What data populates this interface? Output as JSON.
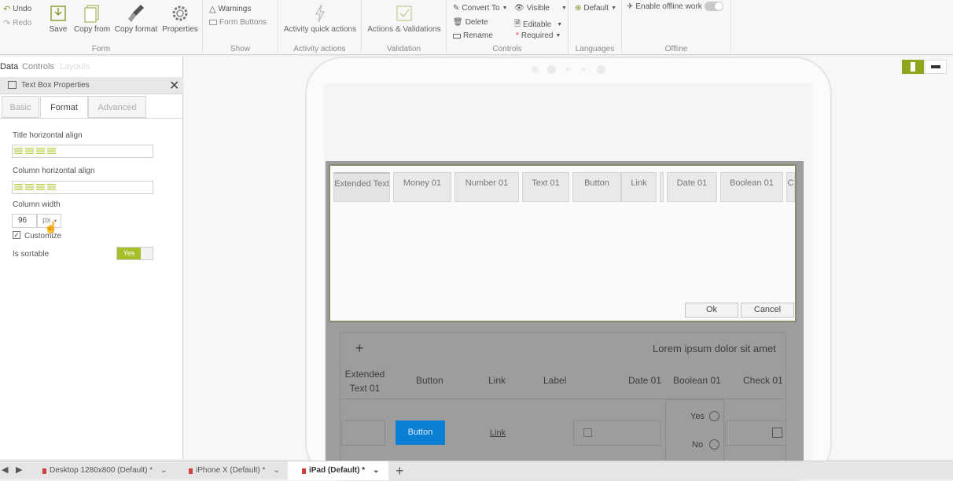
{
  "ribbon": {
    "undo": "Undo",
    "redo": "Redo",
    "save": "Save",
    "copy_from": "Copy from",
    "copy_format": "Copy format",
    "properties": "Properties",
    "form_group": "Form",
    "warnings": "Warnings",
    "form_buttons": "Form Buttons",
    "show_group": "Show",
    "activity_quick_actions": "Activity quick actions",
    "activity_actions_group": "Activity actions",
    "actions_validations": "Actions & Validations",
    "validation_group": "Validation",
    "convert_to": "Convert To",
    "delete": "Delete",
    "rename": "Rename",
    "visible": "Visible",
    "editable": "Editable",
    "required": "Required",
    "controls_group": "Controls",
    "default_language": "Default",
    "languages_group": "Languages",
    "enable_offline": "Enable offline work",
    "offline_group": "Offline"
  },
  "left_panel": {
    "tabs": [
      "Data",
      "Controls",
      "Layouts"
    ],
    "header_title": "Text Box Properties",
    "subtabs": [
      "Basic",
      "Format",
      "Advanced"
    ],
    "active_subtab": "Format",
    "title_align_label": "Title horizontal align",
    "column_align_label": "Column horizontal align",
    "column_width_label": "Column width",
    "column_width_value": "96",
    "column_width_unit": "px",
    "customize_label": "Customize",
    "is_sortable_label": "Is sortable",
    "is_sortable_value": "Yes"
  },
  "dialog": {
    "tabs": [
      "Extended Text",
      "Money 01",
      "Number 01",
      "Text 01",
      "Button",
      "Link",
      "Date 01",
      "Boolean 01",
      "C"
    ],
    "ok": "Ok",
    "cancel": "Cancel"
  },
  "background_grid": {
    "plus": "+",
    "lorem": "Lorem ipsum dolor sit amet",
    "headers": [
      "Extended Text 01",
      "Button",
      "Link",
      "Label",
      "Date 01",
      "Boolean 01",
      "Check 01"
    ],
    "button_label": "Button",
    "link_label": "Link",
    "yes": "Yes",
    "no": "No"
  },
  "bottom_tabs": [
    {
      "label": "Desktop 1280x800 (Default) *"
    },
    {
      "label": "iPhone X (Default) *"
    },
    {
      "label": "iPad (Default) *"
    }
  ],
  "colors": {
    "accent": "#a8bd2a",
    "primary_button": "#0b7fd4",
    "dialog_border": "#8a8a6e"
  }
}
